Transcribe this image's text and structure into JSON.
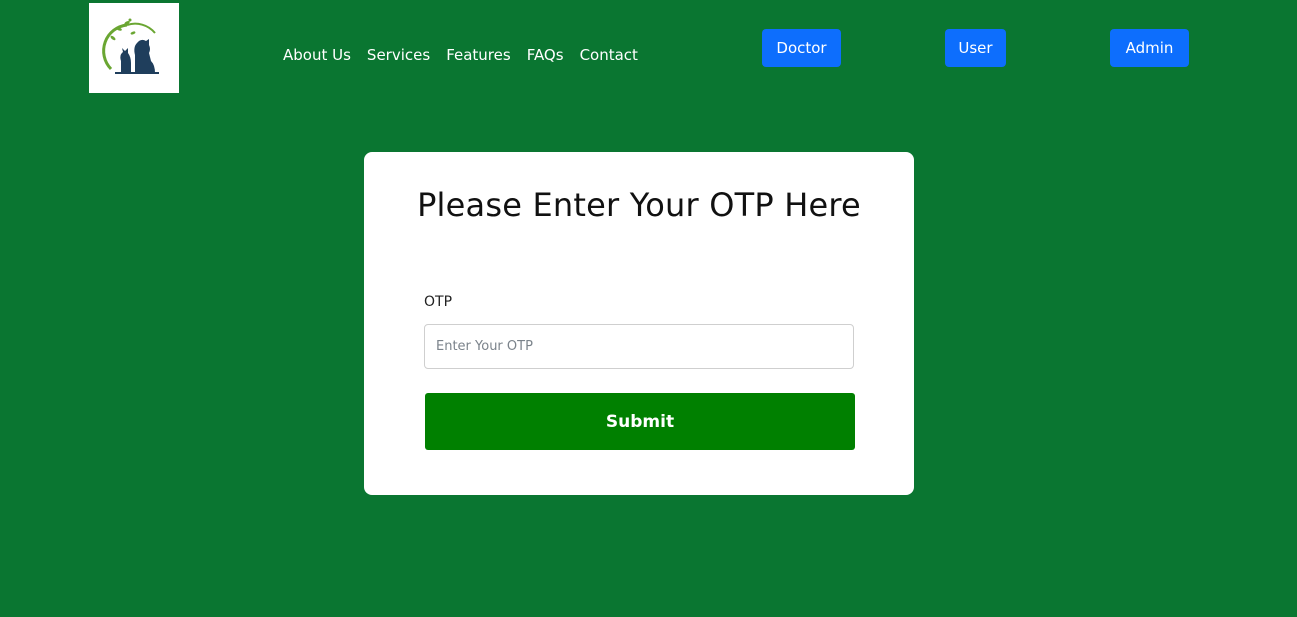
{
  "logo": {
    "icon": "pet-clinic-logo-icon",
    "colors": {
      "leaf": "#6aa632",
      "silhouette": "#1f3e5c"
    }
  },
  "nav": {
    "items": [
      {
        "label": "About Us"
      },
      {
        "label": "Services"
      },
      {
        "label": "Features"
      },
      {
        "label": "FAQs"
      },
      {
        "label": "Contact"
      }
    ]
  },
  "roles": {
    "doctor": "Doctor",
    "user": "User",
    "admin": "Admin"
  },
  "form": {
    "title": "Please Enter Your OTP Here",
    "otp_label": "OTP",
    "otp_placeholder": "Enter Your OTP",
    "otp_value": "",
    "submit_label": "Submit"
  },
  "colors": {
    "page_background": "#0a7631",
    "role_button": "#0d6efd",
    "submit_button": "#008000",
    "card": "#ffffff"
  }
}
